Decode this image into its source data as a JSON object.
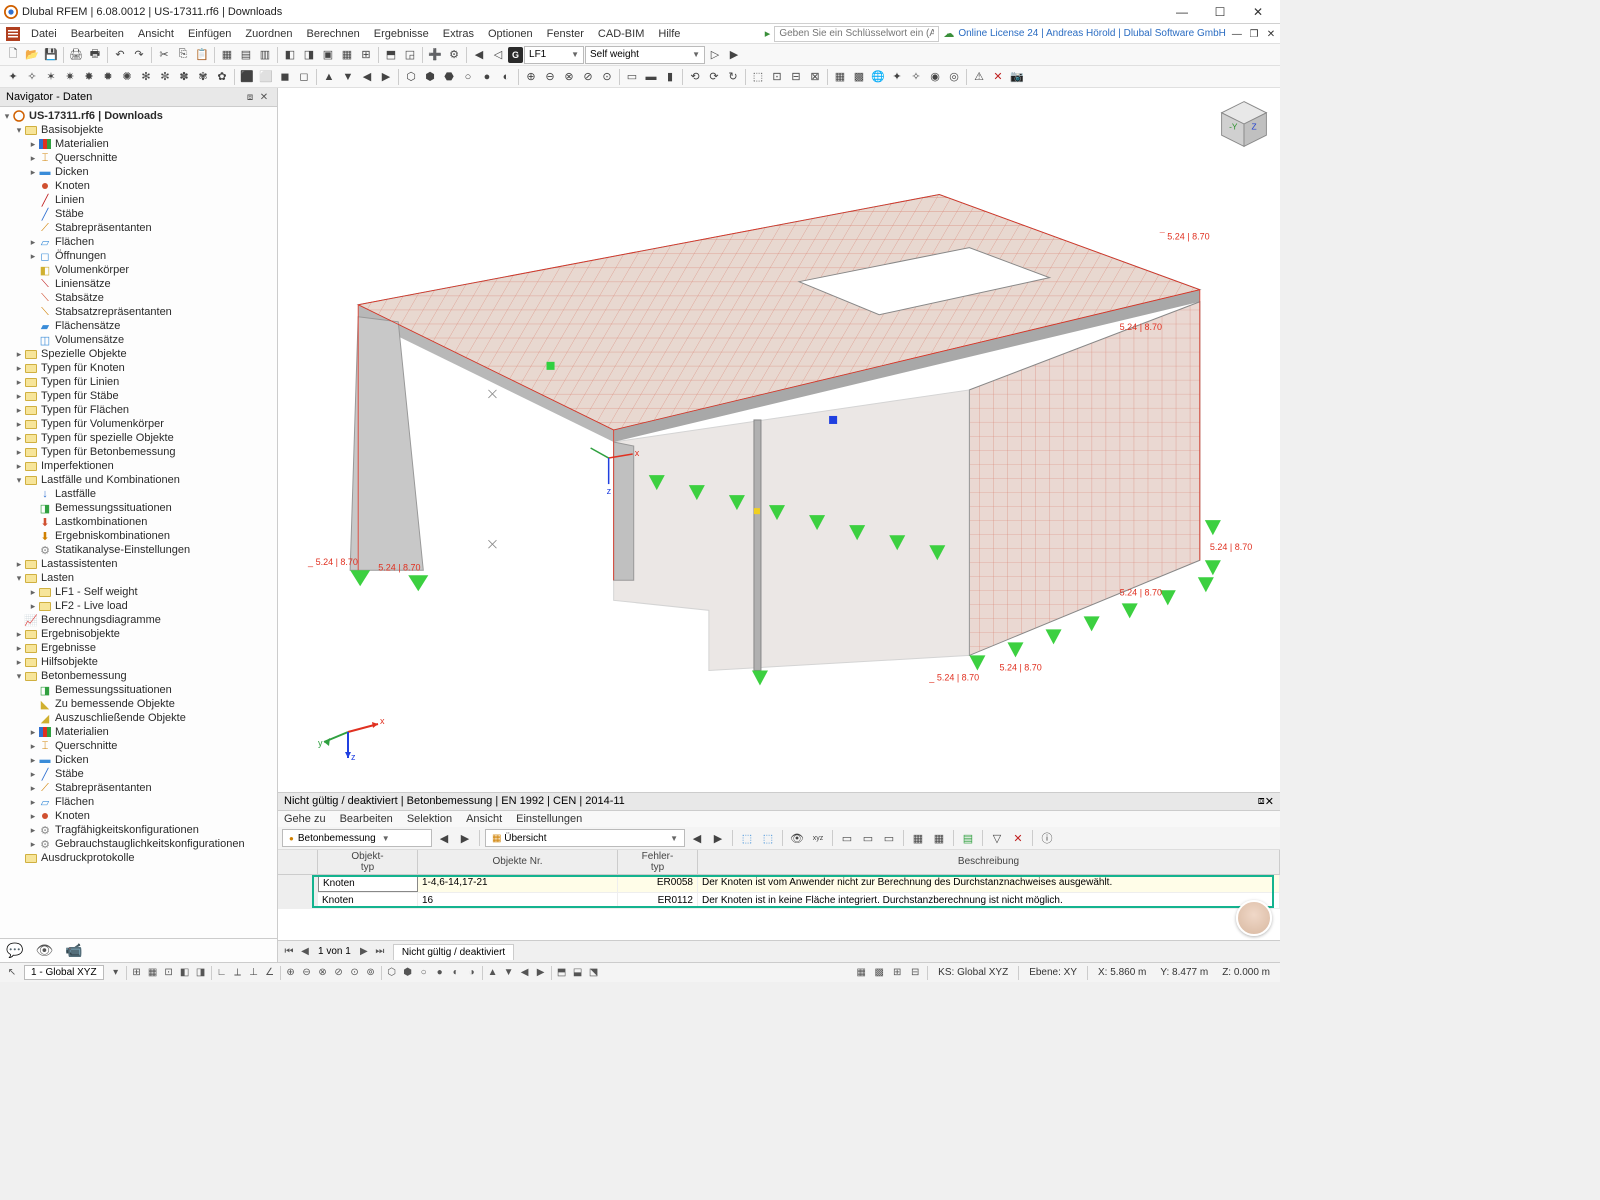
{
  "title": "Dlubal RFEM | 6.08.0012 | US-17311.rf6 | Downloads",
  "keyword_placeholder": "Geben Sie ein Schlüsselwort ein (Alt...",
  "license": "Online License 24 | Andreas Hörold | Dlubal Software GmbH",
  "menu": [
    "Datei",
    "Bearbeiten",
    "Ansicht",
    "Einfügen",
    "Zuordnen",
    "Berechnen",
    "Ergebnisse",
    "Extras",
    "Optionen",
    "Fenster",
    "CAD-BIM",
    "Hilfe"
  ],
  "tb1": {
    "g": "G",
    "lf": "LF1",
    "desc": "Self weight"
  },
  "nav_title": "Navigator - Daten",
  "tree": {
    "root": "US-17311.rf6 | Downloads",
    "basis": "Basisobjekte",
    "materialien": "Materialien",
    "querschnitte": "Querschnitte",
    "dicken": "Dicken",
    "knoten": "Knoten",
    "linien": "Linien",
    "staebe": "Stäbe",
    "stabrep": "Stabrepräsentanten",
    "flaechen": "Flächen",
    "oeffnungen": "Öffnungen",
    "volumenk": "Volumenkörper",
    "liniens": "Liniensätze",
    "stabs": "Stabsätze",
    "stabsrep": "Stabsatzrepräsentanten",
    "flaechens": "Flächensätze",
    "volumens": "Volumensätze",
    "spezielle": "Spezielle Objekte",
    "typ_knoten": "Typen für Knoten",
    "typ_linien": "Typen für Linien",
    "typ_staebe": "Typen für Stäbe",
    "typ_flaechen": "Typen für Flächen",
    "typ_volumen": "Typen für Volumenkörper",
    "typ_spez": "Typen für spezielle Objekte",
    "typ_beton": "Typen für Betonbemessung",
    "imperf": "Imperfektionen",
    "lastfaelle": "Lastfälle und Kombinationen",
    "lf": "Lastfälle",
    "bemsit": "Bemessungssituationen",
    "lastkomb": "Lastkombinationen",
    "ergkomb": "Ergebniskombinationen",
    "statik": "Statikanalyse-Einstellungen",
    "lastass": "Lastassistenten",
    "lasten": "Lasten",
    "lf1": "LF1 - Self weight",
    "lf2": "LF2 - Live load",
    "berechdiag": "Berechnungsdiagramme",
    "ergebobj": "Ergebnisobjekte",
    "ergebnisse": "Ergebnisse",
    "hilfsobj": "Hilfsobjekte",
    "betonbem": "Betonbemessung",
    "bemsit2": "Bemessungssituationen",
    "zubem": "Zu bemessende Objekte",
    "auszu": "Auszuschließende Objekte",
    "mat2": "Materialien",
    "quer2": "Querschnitte",
    "dick2": "Dicken",
    "stab2": "Stäbe",
    "stabrep2": "Stabrepräsentanten",
    "flae2": "Flächen",
    "knot2": "Knoten",
    "tragf": "Tragfähigkeitskonfigurationen",
    "gebr": "Gebrauchstauglichkeitskonfigurationen",
    "ausdr": "Ausdruckprotokolle"
  },
  "dims": {
    "d1": "5.24 | 8.70",
    "d2": "5.24 | 8.70",
    "d3": "5.24 | 8.70",
    "d4": "5.24 | 8.70",
    "d5": "5.24 | 8.70",
    "d6": "5.24 | 8.70",
    "d7": "5.24 | 8.70"
  },
  "axes": {
    "x": "x",
    "y": "y",
    "z": "z",
    "cubeY": "-Y",
    "cubeZ": "Z"
  },
  "bp": {
    "title": "Nicht gültig / deaktiviert | Betonbemessung | EN 1992 | CEN | 2014-11",
    "menu": [
      "Gehe zu",
      "Bearbeiten",
      "Selektion",
      "Ansicht",
      "Einstellungen"
    ],
    "combo1": "Betonbemessung",
    "combo2": "Übersicht",
    "head": {
      "col1a": "Objekt-",
      "col1b": "typ",
      "col2": "Objekte Nr.",
      "col3a": "Fehler-",
      "col3b": "typ",
      "col4": "Beschreibung"
    },
    "rows": [
      {
        "type": "Knoten",
        "objs": "1-4,6-14,17-21",
        "err": "ER0058",
        "desc": "Der Knoten ist vom Anwender nicht zur Berechnung des Durchstanznachweises ausgewählt."
      },
      {
        "type": "Knoten",
        "objs": "16",
        "err": "ER0112",
        "desc": "Der Knoten ist in keine Fläche integriert. Durchstanzberechnung ist nicht möglich."
      }
    ]
  },
  "tabstrip": {
    "page": "1 von 1",
    "tab": "Nicht gültig / deaktiviert"
  },
  "status": {
    "cs_combo": "1 - Global XYZ",
    "ks": "KS: Global XYZ",
    "ebene": "Ebene: XY",
    "x": "X: 5.860 m",
    "y": "Y: 8.477 m",
    "z": "Z: 0.000 m"
  }
}
